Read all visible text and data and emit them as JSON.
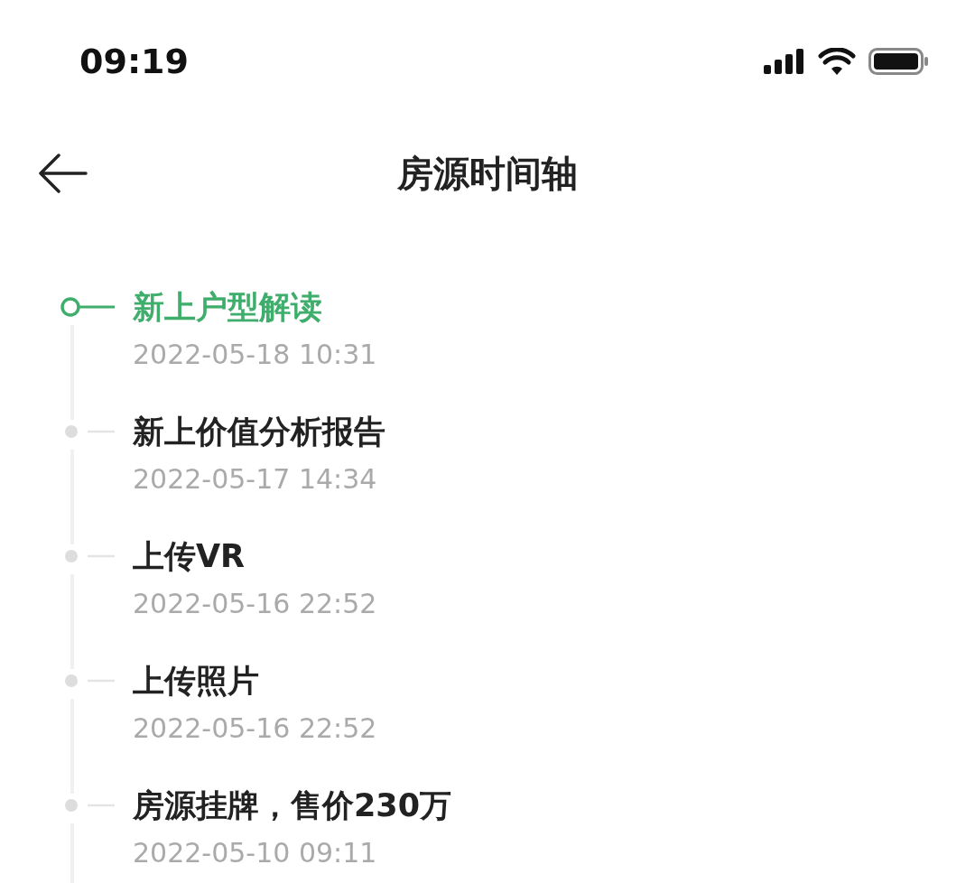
{
  "status_bar": {
    "time": "09:19"
  },
  "header": {
    "title": "房源时间轴"
  },
  "timeline": [
    {
      "title": "新上户型解读",
      "date": "2022-05-18 10:31",
      "current": true
    },
    {
      "title": "新上价值分析报告",
      "date": "2022-05-17 14:34",
      "current": false
    },
    {
      "title": "上传VR",
      "date": "2022-05-16 22:52",
      "current": false
    },
    {
      "title": "上传照片",
      "date": "2022-05-16 22:52",
      "current": false
    },
    {
      "title": "房源挂牌，售价230万",
      "date": "2022-05-10 09:11",
      "current": false
    }
  ]
}
